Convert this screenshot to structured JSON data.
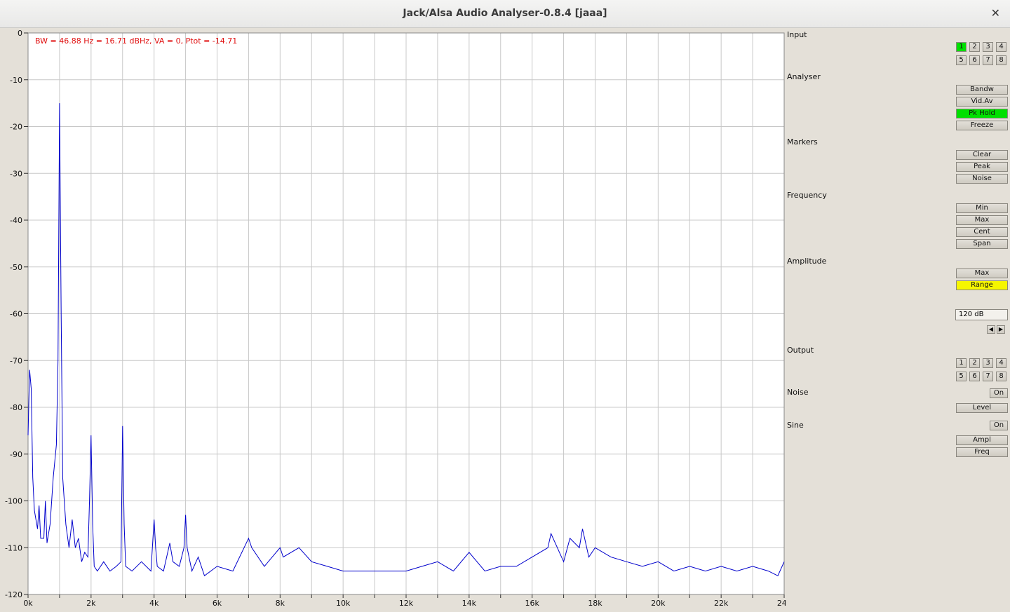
{
  "window": {
    "title": "Jack/Alsa Audio Analyser-0.8.4  [jaaa]",
    "close_glyph": "✕"
  },
  "readout": "BW = 46.88 Hz = 16.71 dBHz, VA = 0, Ptot = -14.71",
  "panel": {
    "input": {
      "label": "Input",
      "channels": [
        "1",
        "2",
        "3",
        "4",
        "5",
        "6",
        "7",
        "8"
      ],
      "active": "1"
    },
    "analyser": {
      "label": "Analyser",
      "buttons": [
        "Bandw",
        "Vid.Av",
        "Pk Hold",
        "Freeze"
      ],
      "active": "Pk Hold"
    },
    "markers": {
      "label": "Markers",
      "buttons": [
        "Clear",
        "Peak",
        "Noise"
      ]
    },
    "frequency": {
      "label": "Frequency",
      "buttons": [
        "Min",
        "Max",
        "Cent",
        "Span"
      ]
    },
    "amplitude": {
      "label": "Amplitude",
      "buttons": [
        "Max",
        "Range"
      ],
      "active": "Range",
      "value": "120 dB"
    },
    "output": {
      "label": "Output",
      "channels": [
        "1",
        "2",
        "3",
        "4",
        "5",
        "6",
        "7",
        "8"
      ]
    },
    "noise": {
      "label": "Noise",
      "on": "On",
      "level": "Level"
    },
    "sine": {
      "label": "Sine",
      "on": "On",
      "buttons": [
        "Ampl",
        "Freq"
      ]
    }
  },
  "colors": {
    "trace": "#0000cc",
    "grid": "#c8c8c8",
    "plot_bg": "#ffffff",
    "readout": "#e01010",
    "active_green": "#00e000",
    "active_yellow": "#f6f600"
  },
  "chart_data": {
    "type": "line",
    "xlim": [
      0,
      24000
    ],
    "ylim": [
      -120,
      0
    ],
    "x_ticks": [
      "0k",
      "2k",
      "4k",
      "6k",
      "8k",
      "10k",
      "12k",
      "14k",
      "16k",
      "18k",
      "20k",
      "22k",
      "24k"
    ],
    "y_ticks": [
      "0",
      "-10",
      "-20",
      "-30",
      "-40",
      "-50",
      "-60",
      "-70",
      "-80",
      "-90",
      "-100",
      "-110",
      "-120"
    ],
    "grid": true,
    "series": [
      {
        "x": [
          0,
          50,
          100,
          150,
          200,
          300,
          350,
          400,
          500,
          550,
          600,
          700,
          800,
          900,
          950,
          1000,
          1050,
          1100,
          1200,
          1300,
          1400,
          1500,
          1600,
          1700,
          1800,
          1900,
          1950,
          2000,
          2050,
          2100,
          2200,
          2400,
          2600,
          2800,
          2950,
          3000,
          3050,
          3100,
          3300,
          3600,
          3900,
          4000,
          4050,
          4100,
          4300,
          4500,
          4600,
          4800,
          4950,
          5000,
          5050,
          5200,
          5400,
          5600,
          6000,
          6500,
          7000,
          7100,
          7500,
          8000,
          8100,
          8600,
          9000,
          9500,
          10000,
          11000,
          12000,
          12500,
          13000,
          13500,
          14000,
          14500,
          15000,
          15500,
          16000,
          16500,
          16600,
          17000,
          17200,
          17500,
          17600,
          17800,
          18000,
          18500,
          19000,
          19500,
          20000,
          20500,
          21000,
          21500,
          22000,
          22500,
          23000,
          23500,
          23800,
          24000
        ],
        "y": [
          -86,
          -72,
          -76,
          -95,
          -102,
          -106,
          -101,
          -108,
          -108,
          -100,
          -109,
          -105,
          -95,
          -88,
          -70,
          -15,
          -60,
          -95,
          -105,
          -110,
          -104,
          -110,
          -108,
          -113,
          -111,
          -112,
          -100,
          -86,
          -105,
          -114,
          -115,
          -113,
          -115,
          -114,
          -113,
          -84,
          -105,
          -114,
          -115,
          -113,
          -115,
          -104,
          -110,
          -114,
          -115,
          -109,
          -113,
          -114,
          -110,
          -103,
          -110,
          -115,
          -112,
          -116,
          -114,
          -115,
          -108,
          -110,
          -114,
          -110,
          -112,
          -110,
          -113,
          -114,
          -115,
          -115,
          -115,
          -114,
          -113,
          -115,
          -111,
          -115,
          -114,
          -114,
          -112,
          -110,
          -107,
          -113,
          -108,
          -110,
          -106,
          -112,
          -110,
          -112,
          -113,
          -114,
          -113,
          -115,
          -114,
          -115,
          -114,
          -115,
          -114,
          -115,
          -116,
          -113
        ]
      }
    ]
  }
}
